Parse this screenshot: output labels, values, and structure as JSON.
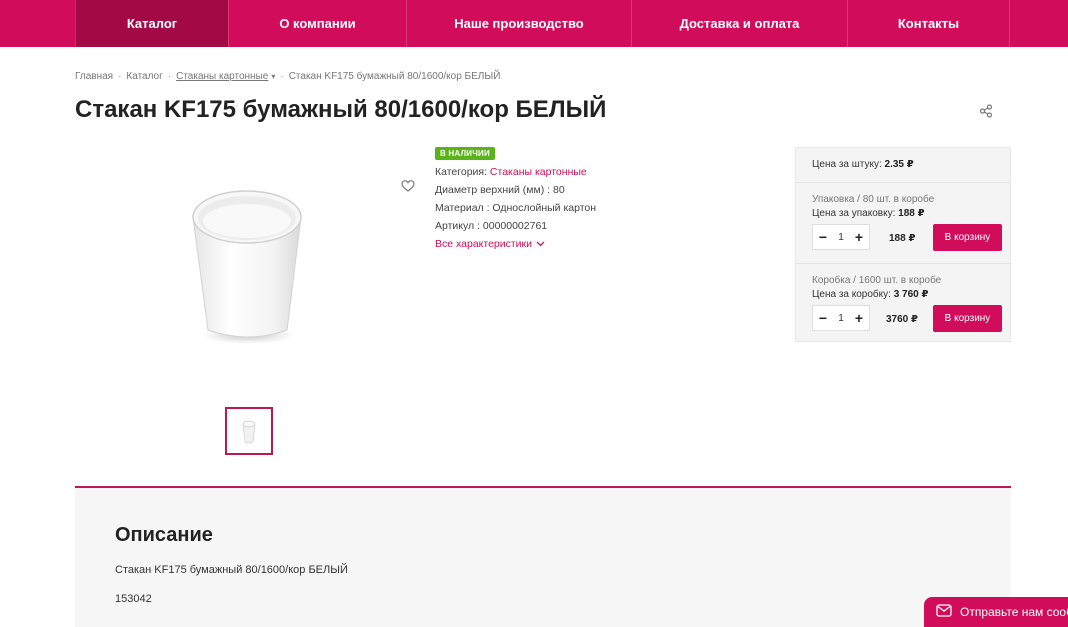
{
  "nav": {
    "items": [
      "Каталог",
      "О компании",
      "Наше производство",
      "Доставка и оплата",
      "Контакты"
    ]
  },
  "breadcrumb": [
    "Главная",
    "Каталог",
    "Стаканы картонные",
    "Стакан KF175 бумажный 80/1600/кор БЕЛЫЙ"
  ],
  "product": {
    "title": "Стакан KF175 бумажный 80/1600/кор БЕЛЫЙ",
    "badge": "В НАЛИЧИИ",
    "category_label": "Категория: ",
    "category_value": "Стаканы картонные",
    "diameter": "Диаметр верхний (мм) : 80",
    "material": "Материал : Однослойный картон",
    "article": "Артикул : 00000002761",
    "all_specs": "Все характеристики"
  },
  "pricing": {
    "unit_label": "Цена за штуку: ",
    "unit_price": "2.35 ₽",
    "pack": {
      "title": "Упаковка / 80 шт. в коробе",
      "label": "Цена за упаковку: ",
      "price": "188 ₽",
      "qty": "1",
      "total": "188 ₽",
      "button": "В корзину"
    },
    "box": {
      "title": "Коробка / 1600 шт. в коробе",
      "label": "Цена за коробку: ",
      "price": "3 760 ₽",
      "qty": "1",
      "total": "3760 ₽",
      "button": "В корзину"
    }
  },
  "description": {
    "heading": "Описание",
    "text": "Стакан KF175 бумажный 80/1600/кор БЕЛЫЙ",
    "code": "153042"
  },
  "chat": {
    "label": "Отправьте нам сообщение"
  },
  "colors": {
    "brand": "#d10c5a",
    "brand_dark": "#a30a45",
    "in_stock": "#5bb31a"
  },
  "icons": [
    "share-icon",
    "heart-icon",
    "chevron-down-icon",
    "minus-icon",
    "plus-icon",
    "envelope-icon"
  ]
}
